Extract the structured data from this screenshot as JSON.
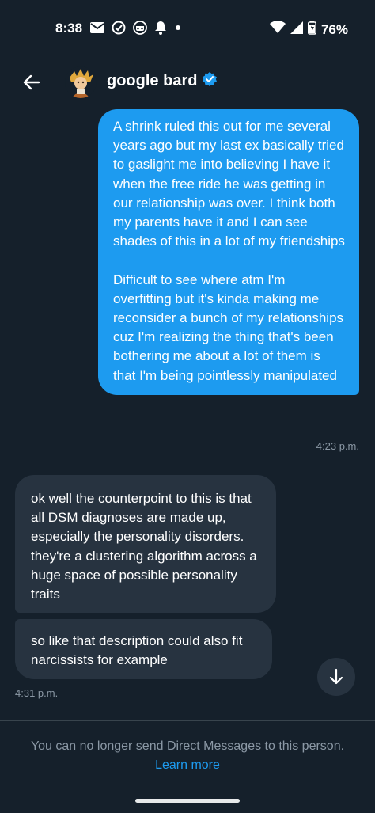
{
  "status_bar": {
    "time": "8:38",
    "battery_percent": "76%",
    "icons_left": [
      "mail-icon",
      "check-circle-icon",
      "incognito-icon",
      "bell-icon",
      "dot-icon"
    ],
    "icons_right": [
      "wifi-icon",
      "signal-icon",
      "battery-icon"
    ]
  },
  "header": {
    "title": "google bard",
    "verified": true,
    "accent": "#1d9bf0"
  },
  "messages": {
    "outgoing": {
      "text": "A shrink ruled this out for me several years ago but my last ex basically tried to gaslight me into believing I have it when the free ride he was getting in our relationship was over. I think both my parents have it and I can see shades of this in a lot of my friendships\n\nDifficult to see where atm I'm overfitting but it's kinda making me reconsider a bunch of my relationships cuz I'm realizing the thing that's been bothering me about a lot of them is that I'm being pointlessly manipulated",
      "time": "4:23 p.m."
    },
    "incoming": [
      {
        "text": "ok well the counterpoint to this is that all DSM diagnoses are made up, especially the personality disorders. they're a clustering algorithm across a huge space of possible personality traits"
      },
      {
        "text": "so like that description could also fit narcissists for example"
      }
    ],
    "incoming_time": "4:31 p.m."
  },
  "footer": {
    "notice": "You can no longer send Direct Messages to this person.",
    "learn_more": "Learn more"
  }
}
